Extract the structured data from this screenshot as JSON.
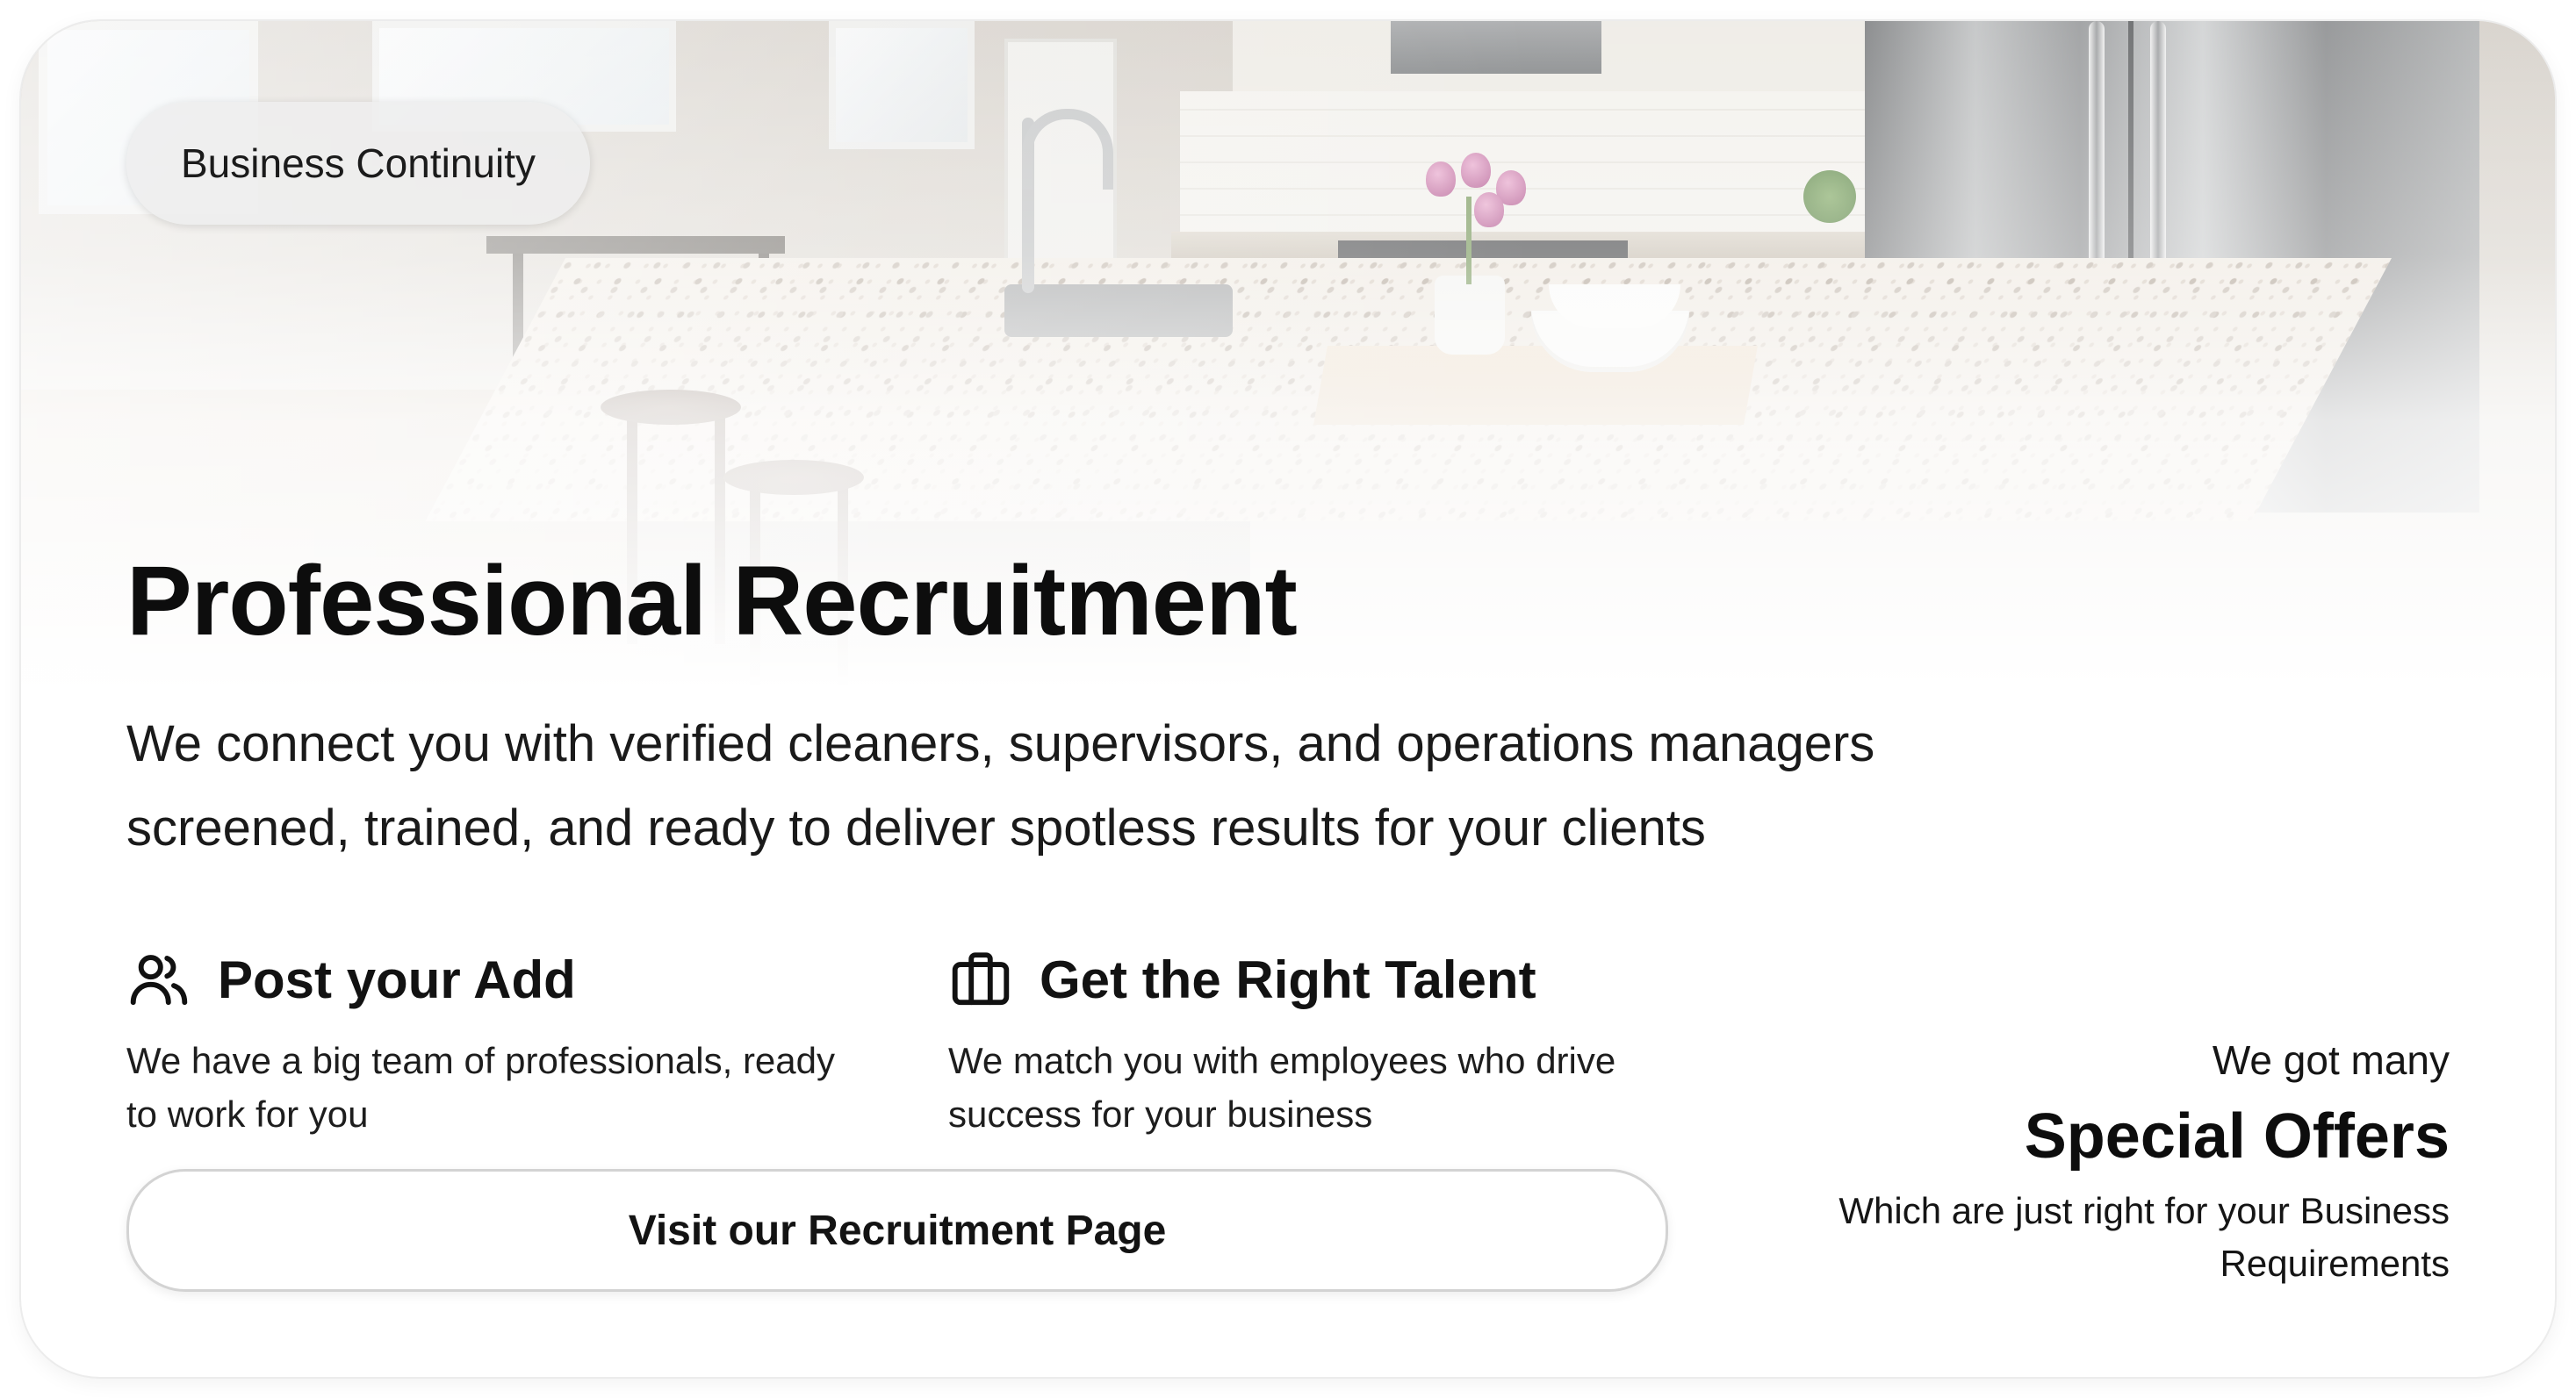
{
  "badge": {
    "label": "Business Continuity"
  },
  "hero": {
    "title": "Professional Recruitment",
    "subtitle": "We connect you with verified cleaners, supervisors, and operations managers screened, trained, and ready to deliver spotless results for your clients",
    "image_subject": "kitchen-interior-photo"
  },
  "features": [
    {
      "icon": "users-icon",
      "title": "Post your Add",
      "description": "We have a big team of professionals, ready to work for you"
    },
    {
      "icon": "briefcase-icon",
      "title": "Get the Right Talent",
      "description": "We match you with employees who drive success for your business"
    }
  ],
  "cta": {
    "label": "Visit our Recruitment Page"
  },
  "offers": {
    "kicker": "We got many",
    "heading": "Special Offers",
    "description": "Which are just right for your Business Requirements"
  },
  "colors": {
    "text": "#111111",
    "background": "#ffffff",
    "pill_background": "#eeeeee",
    "button_border": "#d3d3d3"
  }
}
